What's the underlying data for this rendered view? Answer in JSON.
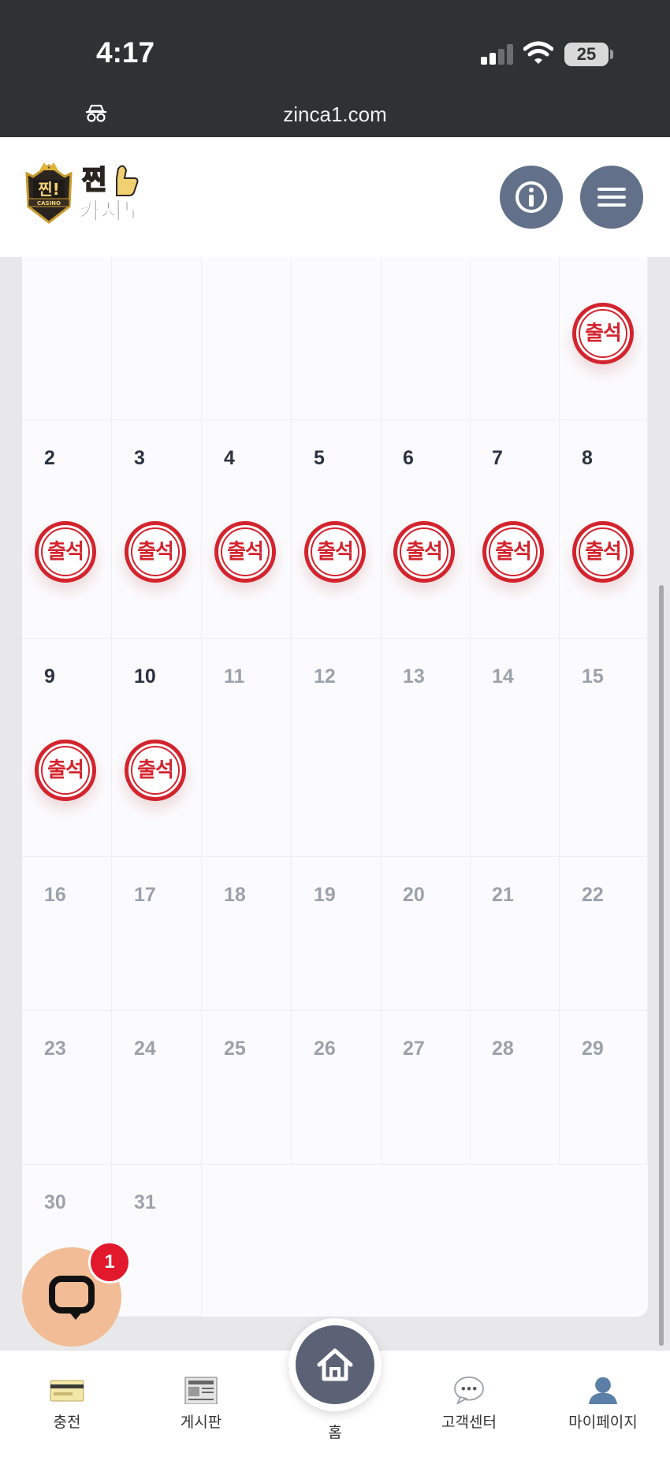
{
  "status_bar": {
    "time": "4:17",
    "battery": "25",
    "url": "zinca1.com"
  },
  "header": {
    "logo_text": "찐!카지노",
    "logo_badge": "CASINO"
  },
  "calendar": {
    "stamp_label": "출석",
    "rows": [
      [
        {
          "day": "",
          "stamp": false,
          "state": "empty"
        },
        {
          "day": "",
          "stamp": false,
          "state": "empty"
        },
        {
          "day": "",
          "stamp": false,
          "state": "empty"
        },
        {
          "day": "",
          "stamp": false,
          "state": "empty"
        },
        {
          "day": "",
          "stamp": false,
          "state": "empty"
        },
        {
          "day": "",
          "stamp": false,
          "state": "empty"
        },
        {
          "day": "",
          "stamp": true,
          "state": "active"
        }
      ],
      [
        {
          "day": "2",
          "stamp": true,
          "state": "active"
        },
        {
          "day": "3",
          "stamp": true,
          "state": "active"
        },
        {
          "day": "4",
          "stamp": true,
          "state": "active"
        },
        {
          "day": "5",
          "stamp": true,
          "state": "active"
        },
        {
          "day": "6",
          "stamp": true,
          "state": "active"
        },
        {
          "day": "7",
          "stamp": true,
          "state": "active"
        },
        {
          "day": "8",
          "stamp": true,
          "state": "active"
        }
      ],
      [
        {
          "day": "9",
          "stamp": true,
          "state": "active"
        },
        {
          "day": "10",
          "stamp": true,
          "state": "active"
        },
        {
          "day": "11",
          "stamp": false,
          "state": "future"
        },
        {
          "day": "12",
          "stamp": false,
          "state": "future"
        },
        {
          "day": "13",
          "stamp": false,
          "state": "future"
        },
        {
          "day": "14",
          "stamp": false,
          "state": "future"
        },
        {
          "day": "15",
          "stamp": false,
          "state": "future"
        }
      ],
      [
        {
          "day": "16",
          "stamp": false,
          "state": "future"
        },
        {
          "day": "17",
          "stamp": false,
          "state": "future"
        },
        {
          "day": "18",
          "stamp": false,
          "state": "future"
        },
        {
          "day": "19",
          "stamp": false,
          "state": "future"
        },
        {
          "day": "20",
          "stamp": false,
          "state": "future"
        },
        {
          "day": "21",
          "stamp": false,
          "state": "future"
        },
        {
          "day": "22",
          "stamp": false,
          "state": "future"
        }
      ],
      [
        {
          "day": "23",
          "stamp": false,
          "state": "future"
        },
        {
          "day": "24",
          "stamp": false,
          "state": "future"
        },
        {
          "day": "25",
          "stamp": false,
          "state": "future"
        },
        {
          "day": "26",
          "stamp": false,
          "state": "future"
        },
        {
          "day": "27",
          "stamp": false,
          "state": "future"
        },
        {
          "day": "28",
          "stamp": false,
          "state": "future"
        },
        {
          "day": "29",
          "stamp": false,
          "state": "future"
        }
      ],
      [
        {
          "day": "30",
          "stamp": false,
          "state": "future"
        },
        {
          "day": "31",
          "stamp": false,
          "state": "future"
        }
      ]
    ]
  },
  "chat": {
    "badge_count": "1"
  },
  "bottom_nav": {
    "items": [
      {
        "label": "충전",
        "icon": "card-icon"
      },
      {
        "label": "게시판",
        "icon": "newspaper-icon"
      },
      {
        "label": "홈",
        "icon": "home-icon"
      },
      {
        "label": "고객센터",
        "icon": "speech-bubble-icon"
      },
      {
        "label": "마이페이지",
        "icon": "user-icon"
      }
    ]
  },
  "colors": {
    "stamp_red": "#d3242e",
    "header_button": "#627189",
    "home_button": "#5b6276",
    "chat_button": "#f2bd96",
    "badge_red": "#e2182d"
  }
}
